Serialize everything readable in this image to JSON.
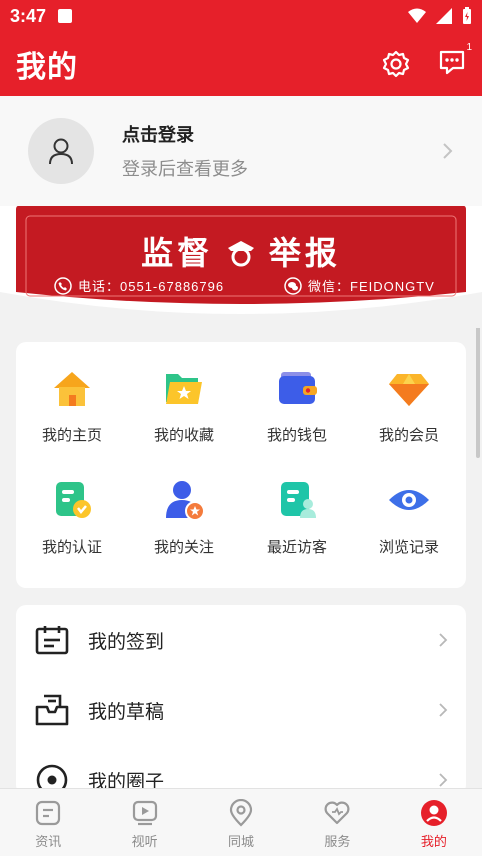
{
  "status_bar": {
    "time": "3:47"
  },
  "header": {
    "title": "我的",
    "message_badge": "1"
  },
  "profile": {
    "login_text": "点击登录",
    "subtitle": "登录后查看更多"
  },
  "banner": {
    "title_left": "监督",
    "title_right": "举报",
    "phone": "电话：0551-67886796",
    "wechat": "微信：FEIDONGTV"
  },
  "grid": {
    "items": [
      {
        "label": "我的主页",
        "icon": "home-icon"
      },
      {
        "label": "我的收藏",
        "icon": "favorites-folder-icon"
      },
      {
        "label": "我的钱包",
        "icon": "wallet-icon"
      },
      {
        "label": "我的会员",
        "icon": "diamond-icon"
      },
      {
        "label": "我的认证",
        "icon": "verified-doc-icon"
      },
      {
        "label": "我的关注",
        "icon": "follow-user-icon"
      },
      {
        "label": "最近访客",
        "icon": "visitor-icon"
      },
      {
        "label": "浏览记录",
        "icon": "eye-icon"
      }
    ]
  },
  "list": {
    "items": [
      {
        "label": "我的签到",
        "icon": "calendar-icon"
      },
      {
        "label": "我的草稿",
        "icon": "drafts-inbox-icon"
      },
      {
        "label": "我的圈子",
        "icon": "circle-icon"
      }
    ]
  },
  "tabbar": {
    "items": [
      {
        "label": "资讯",
        "icon": "news-icon"
      },
      {
        "label": "视听",
        "icon": "video-icon"
      },
      {
        "label": "同城",
        "icon": "location-icon"
      },
      {
        "label": "服务",
        "icon": "heart-icon"
      },
      {
        "label": "我的",
        "icon": "me-icon"
      }
    ],
    "active_index": 4
  },
  "colors": {
    "brand_red": "#e6202a",
    "banner_red": "#c41a22"
  }
}
